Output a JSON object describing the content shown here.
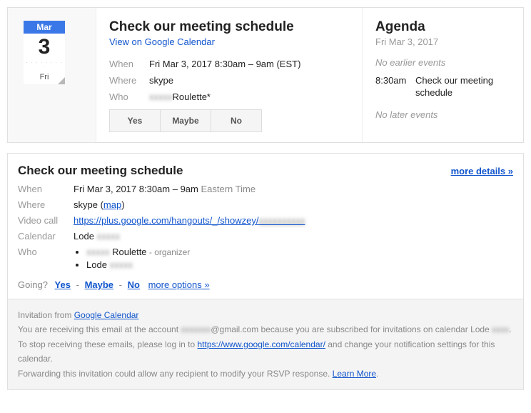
{
  "dateTile": {
    "month": "Mar",
    "day": "3",
    "weekday": "Fri"
  },
  "event": {
    "title": "Check our meeting schedule",
    "viewLink": "View on Google Calendar",
    "when": "Fri Mar 3, 2017 8:30am – 9am (EST)",
    "where": "skype",
    "whoMasked": "xxxxx",
    "whoName": "Roulette*",
    "labels": {
      "when": "When",
      "where": "Where",
      "who": "Who"
    },
    "rsvp": {
      "yes": "Yes",
      "maybe": "Maybe",
      "no": "No"
    }
  },
  "agenda": {
    "title": "Agenda",
    "date": "Fri Mar 3, 2017",
    "noEarlier": "No earlier events",
    "noLater": "No later events",
    "item": {
      "time": "8:30am",
      "name": "Check our meeting schedule"
    }
  },
  "detail": {
    "title": "Check our meeting schedule",
    "moreDetails": "more details »",
    "labels": {
      "when": "When",
      "where": "Where",
      "video": "Video call",
      "calendar": "Calendar",
      "who": "Who"
    },
    "whenMain": "Fri Mar 3, 2017 8:30am – 9am ",
    "whenTz": "Eastern Time",
    "whereText": "skype (",
    "mapLink": "map",
    "whereClose": ")",
    "videoUrl": "https://plus.google.com/hangouts/_/showzey/",
    "videoMasked": "xxxxxxxxxx",
    "calendarName": "Lode ",
    "calendarMasked": "xxxxx",
    "who": [
      {
        "masked": "xxxxx",
        "name": " Roulette",
        "tag": " - organizer"
      },
      {
        "masked": "",
        "name": "Lode ",
        "tag": "",
        "trailingMasked": "xxxxx"
      }
    ],
    "going": {
      "label": "Going?",
      "yes": "Yes",
      "maybe": "Maybe",
      "no": "No",
      "options": "more options »"
    }
  },
  "footer": {
    "l1a": "Invitation from ",
    "l1b": "Google Calendar",
    "l2a": "You are receiving this email at the account ",
    "l2mask": "xxxxxxx",
    "l2b": "@gmail.com because you are subscribed for invitations on calendar Lode ",
    "l2mask2": "xxxx",
    "l2c": ".",
    "l3a": "To stop receiving these emails, please log in to ",
    "l3b": "https://www.google.com/calendar/",
    "l3c": " and change your notification settings for this calendar.",
    "l4a": "Forwarding this invitation could allow any recipient to modify your RSVP response. ",
    "l4b": "Learn More",
    "l4c": "."
  }
}
